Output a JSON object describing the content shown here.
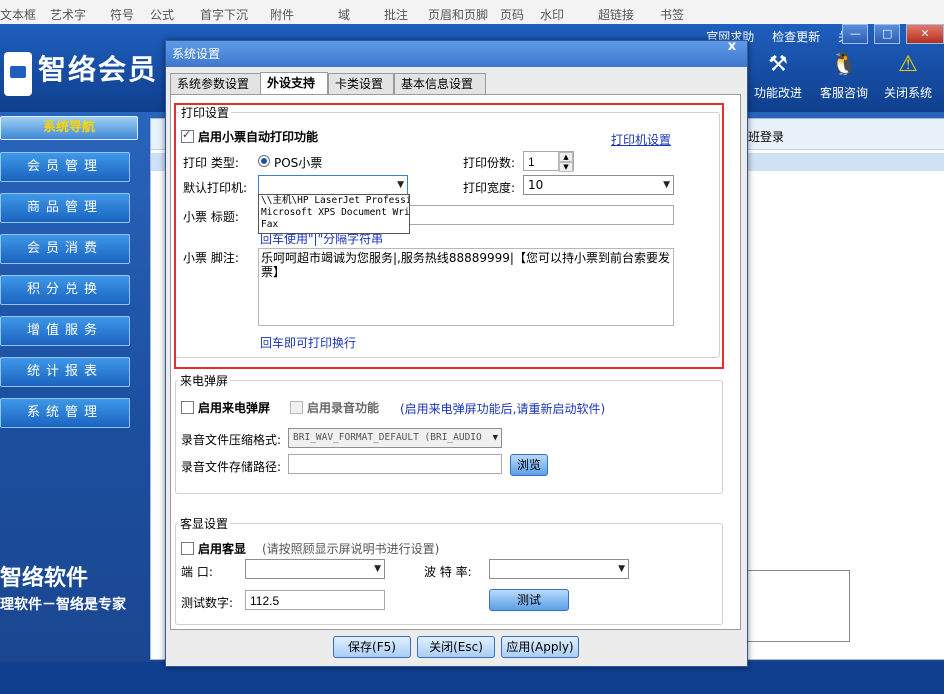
{
  "ribbon": {
    "items": [
      "文本框",
      "艺术字",
      "符号",
      "公式",
      "首字下沉",
      "附件",
      "域",
      "批注",
      "页眉和页脚",
      "页码",
      "水印",
      "超链接",
      "书签"
    ]
  },
  "app": {
    "logo": "智络会员",
    "top_links": [
      "官网求助",
      "检查更新",
      "关于"
    ],
    "window_buttons": [
      "—",
      "□",
      "✕"
    ],
    "toolbar": [
      {
        "label": "功能改进",
        "icon": "tools-icon"
      },
      {
        "label": "客服咨询",
        "icon": "qq-icon"
      },
      {
        "label": "关闭系统",
        "icon": "warning-icon"
      }
    ],
    "nav_header": "系统导航",
    "nav_items": [
      "会员管理",
      "商品管理",
      "会员消费",
      "积分兑换",
      "增值服务",
      "统计报表",
      "系统管理"
    ],
    "shift_login": "班登录",
    "brand": "智络软件",
    "brand_slogan": "理软件－智络是专家"
  },
  "dialog": {
    "title": "系统设置",
    "close": "x",
    "tabs": [
      "系统参数设置",
      "外设支持",
      "卡类设置",
      "基本信息设置"
    ],
    "active_tab": "外设支持",
    "print": {
      "group_label": "打印设置",
      "enable_label": "启用小票自动打印功能",
      "enabled": true,
      "printer_settings_link": "打印机设置",
      "type_label": "打印  类型:",
      "type_value": "POS小票",
      "copies_label": "打印份数:",
      "copies_value": "1",
      "default_printer_label": "默认打印机:",
      "default_printer_value": "",
      "printer_options": [
        "\\\\主机\\HP LaserJet Professional",
        "Microsoft XPS Document Writer",
        "Fax"
      ],
      "width_label": "打印宽度:",
      "width_value": "10",
      "title_label": "小票  标题:",
      "title_value": "",
      "title_hint": "回车使用\"|\"分隔字符串",
      "footer_label": "小票  脚注:",
      "footer_value": "乐呵呵超市竭诚为您服务|,服务热线88889999|【您可以持小票到前台索要发票】",
      "footer_hint": "回车即可打印换行"
    },
    "caller": {
      "group_label": "来电弹屏",
      "enable_label": "启用来电弹屏",
      "enable_checked": false,
      "record_label": "启用录音功能",
      "record_checked": false,
      "note": "(启用来电弹屏功能后,请重新启动软件)",
      "format_label": "录音文件压缩格式:",
      "format_value": "BRI_WAV_FORMAT_DEFAULT (BRI_AUDIO",
      "path_label": "录音文件存储路径:",
      "path_value": "",
      "browse_label": "浏览"
    },
    "display": {
      "group_label": "客显设置",
      "enable_label": "启用客显",
      "enable_checked": false,
      "note": "(请按照顾显示屏说明书进行设置)",
      "port_label": "端    口:",
      "port_value": "",
      "baud_label": "波 特 率:",
      "baud_value": "",
      "test_label": "测试数字:",
      "test_value": "112.5",
      "test_button": "测试"
    },
    "buttons": {
      "save": "保存(F5)",
      "close": "关闭(Esc)",
      "apply": "应用(Apply)"
    }
  }
}
